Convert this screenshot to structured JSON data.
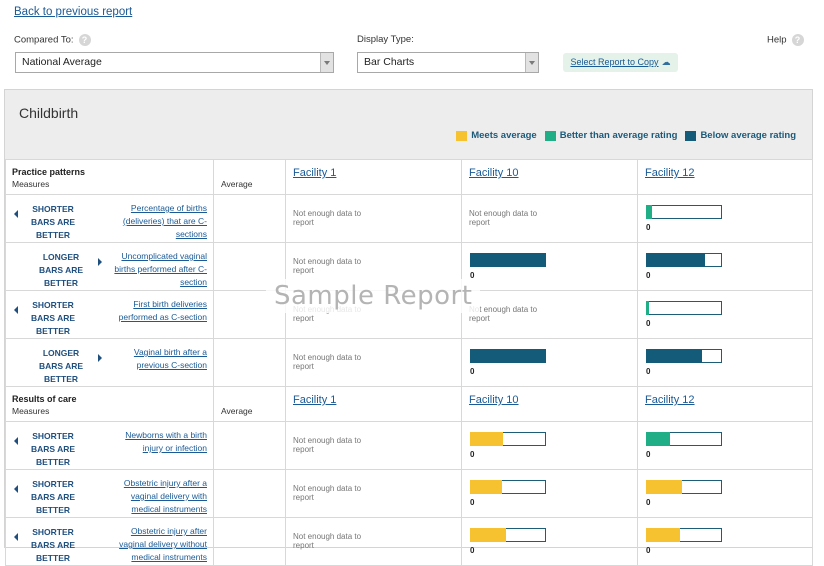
{
  "header": {
    "back_link": "Back to previous report",
    "compared_label": "Compared To:",
    "compared_value": "National Average",
    "display_label": "Display Type:",
    "display_value": "Bar Charts",
    "copy_button": "Select Report to Copy",
    "help": "Help",
    "help_glyph": "?"
  },
  "report": {
    "title": "Childbirth",
    "watermark": "Sample Report",
    "legend": [
      {
        "label": "Meets average",
        "color": "#f7c22f"
      },
      {
        "label": "Better than average rating",
        "color": "#1fae85"
      },
      {
        "label": "Below average rating",
        "color": "#135b78"
      }
    ],
    "sections": [
      {
        "title": "Practice patterns",
        "subtitle": "Measures",
        "average_label": "Average",
        "facilities": [
          "Facility 1",
          "Facility 10",
          "Facility 12"
        ],
        "rows": [
          {
            "direction": "SHORTER BARS ARE BETTER",
            "arrow": "left",
            "measure": "Percentage of births (deliveries) that are C-sections",
            "cells": [
              {
                "nodata": "Not enough data to report"
              },
              {
                "nodata": "Not enough data to report"
              },
              {
                "value": "0",
                "fill": 0.08,
                "color": "#1fae85"
              }
            ]
          },
          {
            "direction": "LONGER BARS ARE BETTER",
            "arrow": "right",
            "measure": "Uncomplicated vaginal births performed after C-section",
            "cells": [
              {
                "nodata": "Not enough data to report"
              },
              {
                "value": "0",
                "fill": 1.0,
                "color": "#135b78"
              },
              {
                "value": "0",
                "fill": 0.78,
                "color": "#135b78"
              }
            ]
          },
          {
            "direction": "SHORTER BARS ARE BETTER",
            "arrow": "left",
            "measure": "First birth deliveries performed as C-section",
            "cells": [
              {
                "nodata": "Not enough data to report"
              },
              {
                "nodata": "Not enough data to report"
              },
              {
                "value": "0",
                "fill": 0.04,
                "color": "#1fae85"
              }
            ]
          },
          {
            "direction": "LONGER BARS ARE BETTER",
            "arrow": "right",
            "measure": "Vaginal birth after a previous C-section",
            "cells": [
              {
                "nodata": "Not enough data to report"
              },
              {
                "value": "0",
                "fill": 1.0,
                "color": "#135b78"
              },
              {
                "value": "0",
                "fill": 0.74,
                "color": "#135b78"
              }
            ]
          }
        ]
      },
      {
        "title": "Results of care",
        "subtitle": "Measures",
        "average_label": "Average",
        "facilities": [
          "Facility 1",
          "Facility 10",
          "Facility 12"
        ],
        "rows": [
          {
            "direction": "SHORTER BARS ARE BETTER",
            "arrow": "left",
            "measure": "Newborns with a birth injury or infection",
            "cells": [
              {
                "nodata": "Not enough data to report"
              },
              {
                "value": "0",
                "fill": 0.44,
                "color": "#f7c22f"
              },
              {
                "value": "0",
                "fill": 0.32,
                "color": "#1fae85"
              }
            ]
          },
          {
            "direction": "SHORTER BARS ARE BETTER",
            "arrow": "left",
            "measure": "Obstetric injury after a vaginal delivery with medical instruments",
            "cells": [
              {
                "nodata": "Not enough data to report"
              },
              {
                "value": "0",
                "fill": 0.42,
                "color": "#f7c22f"
              },
              {
                "value": "0",
                "fill": 0.47,
                "color": "#f7c22f"
              }
            ]
          },
          {
            "direction": "SHORTER BARS ARE BETTER",
            "arrow": "left",
            "measure": "Obstetric injury after vaginal delivery without medical instruments",
            "cells": [
              {
                "nodata": "Not enough data to report"
              },
              {
                "value": "0",
                "fill": 0.48,
                "color": "#f7c22f"
              },
              {
                "value": "0",
                "fill": 0.45,
                "color": "#f7c22f"
              }
            ]
          }
        ]
      }
    ]
  }
}
